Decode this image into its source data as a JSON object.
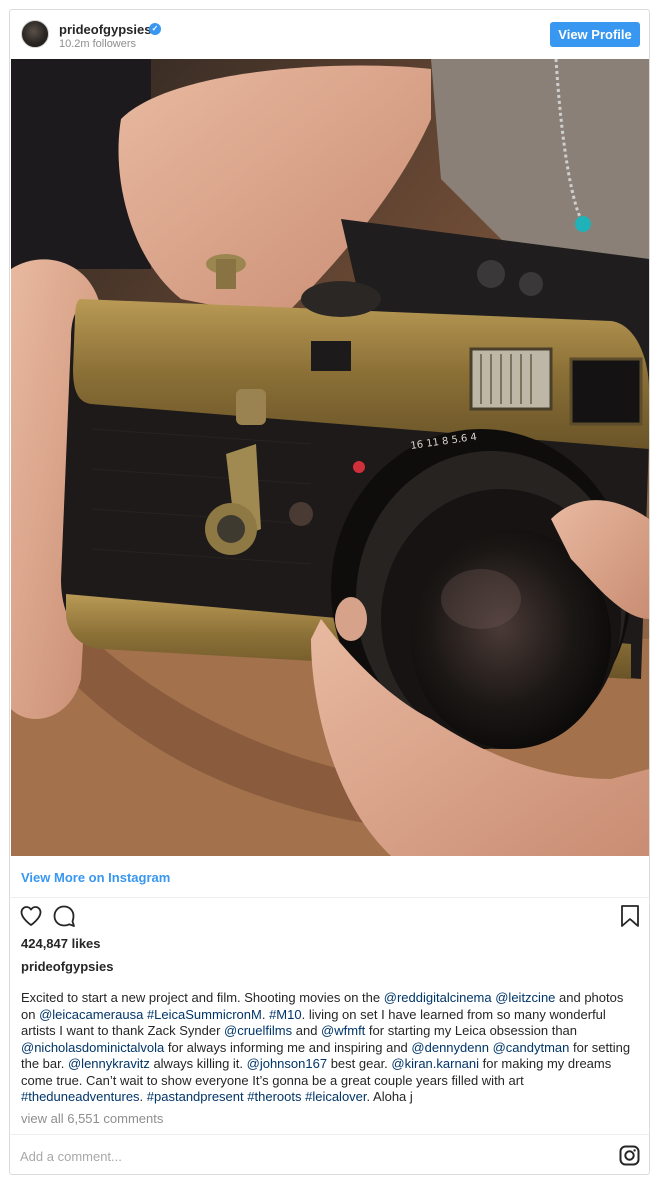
{
  "header": {
    "username": "prideofgypsies",
    "followers": "10.2m followers",
    "view_profile_label": "View Profile"
  },
  "post": {
    "view_more_label": "View More on Instagram",
    "likes": "424,847 likes",
    "owner": "prideofgypsies",
    "caption_parts": [
      {
        "t": "Excited to start a new project and film. Shooting movies on the "
      },
      {
        "t": "@reddigitalcinema",
        "tag": true
      },
      {
        "t": " "
      },
      {
        "t": "@leitzcine",
        "tag": true
      },
      {
        "t": " and photos on "
      },
      {
        "t": "@leicacamerausa",
        "tag": true
      },
      {
        "t": " "
      },
      {
        "t": "#LeicaSummicronM",
        "tag": true
      },
      {
        "t": ". "
      },
      {
        "t": "#M10",
        "tag": true
      },
      {
        "t": ". living on set I have learned from so many wonderful artists I want to thank Zack Synder "
      },
      {
        "t": "@cruelfilms",
        "tag": true
      },
      {
        "t": " and "
      },
      {
        "t": "@wfmft",
        "tag": true
      },
      {
        "t": " for starting my Leica obsession than "
      },
      {
        "t": "@nicholasdominictalvola",
        "tag": true
      },
      {
        "t": " for always informing me and inspiring and "
      },
      {
        "t": "@dennydenn",
        "tag": true
      },
      {
        "t": " "
      },
      {
        "t": "@candytman",
        "tag": true
      },
      {
        "t": " for setting the bar. "
      },
      {
        "t": "@lennykravitz",
        "tag": true
      },
      {
        "t": " always killing it. "
      },
      {
        "t": "@johnson167",
        "tag": true
      },
      {
        "t": " best gear. "
      },
      {
        "t": "@kiran.karnani",
        "tag": true
      },
      {
        "t": " for making my dreams come true. Can’t wait to show everyone It’s gonna be a great couple years filled with art "
      },
      {
        "t": "#theduneadventures",
        "tag": true
      },
      {
        "t": ". "
      },
      {
        "t": "#pastandpresent",
        "tag": true
      },
      {
        "t": " "
      },
      {
        "t": "#theroots",
        "tag": true
      },
      {
        "t": " "
      },
      {
        "t": "#leicalover",
        "tag": true
      },
      {
        "t": ". Aloha j"
      }
    ],
    "view_all_comments": "view all 6,551 comments",
    "add_comment_placeholder": "Add a comment..."
  },
  "icons": {
    "verified": "verified-badge-icon",
    "like": "heart-icon",
    "comment": "speech-bubble-icon",
    "save": "bookmark-icon",
    "brand": "instagram-icon"
  },
  "colors": {
    "accent": "#3897f0",
    "link": "#003569",
    "muted": "#8e8e8e",
    "text": "#262626",
    "border": "#dbdbdb"
  }
}
